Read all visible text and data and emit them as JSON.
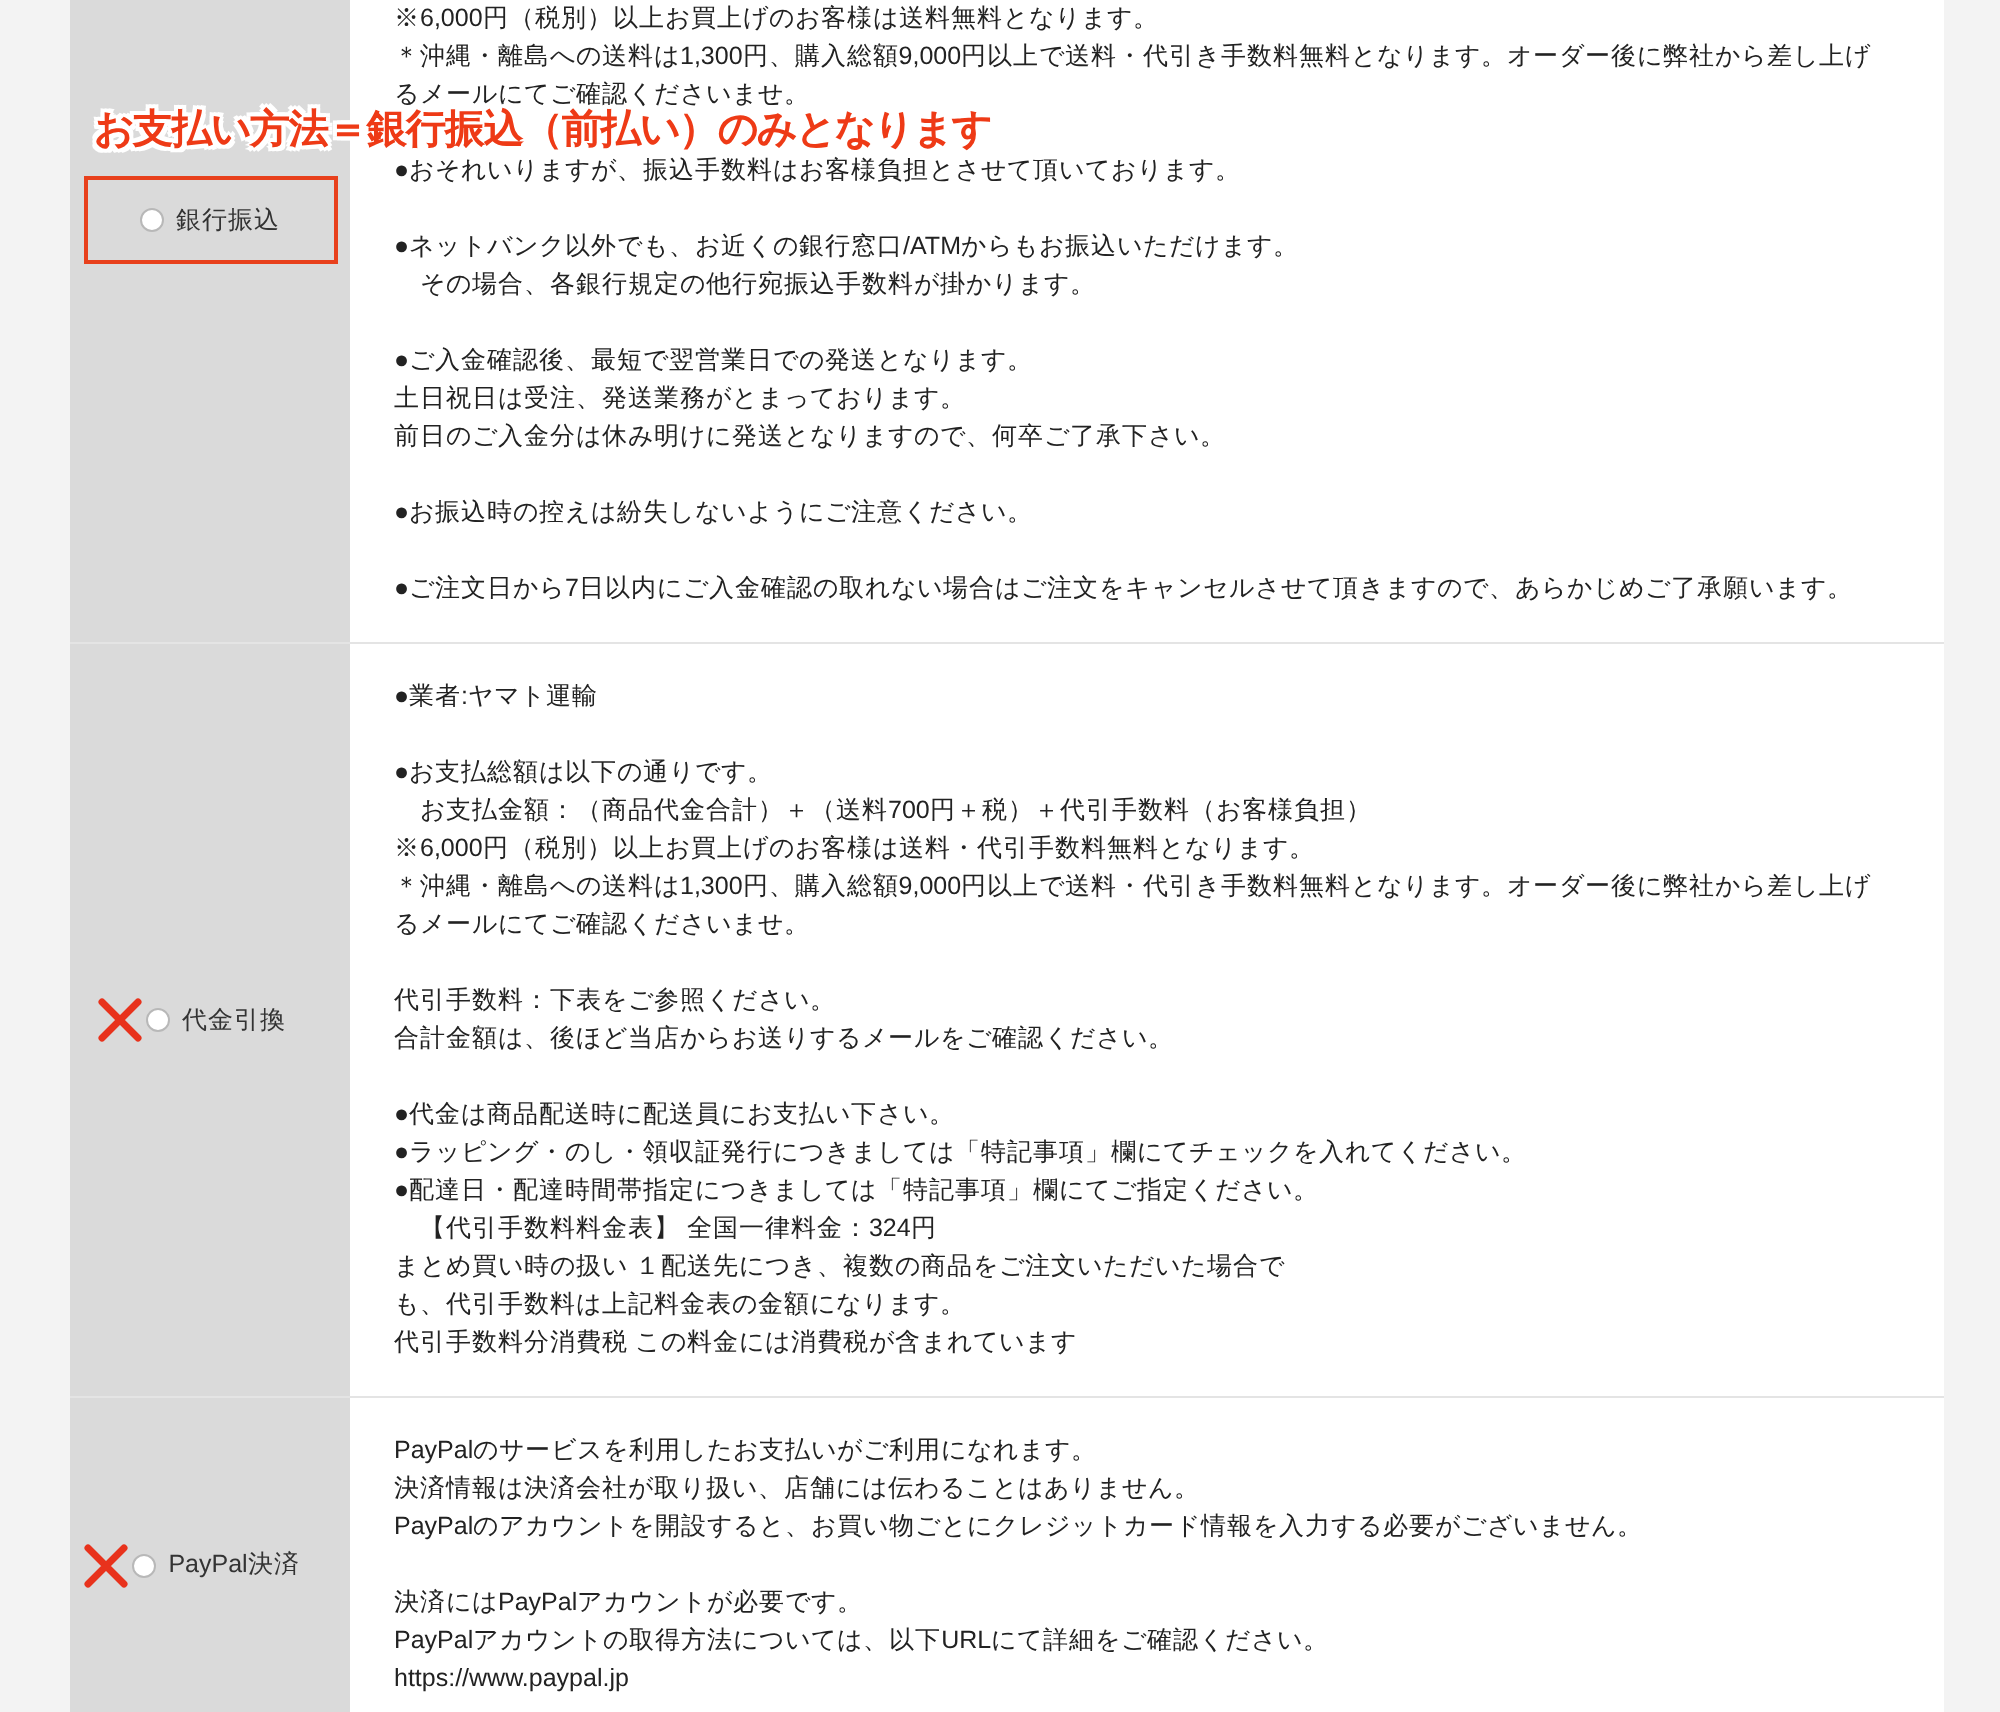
{
  "annotation": "お支払い方法＝銀行振込（前払い）のみとなります",
  "payment_methods": [
    {
      "label": "銀行振込",
      "selected": false,
      "highlighted": true,
      "crossed_out": false,
      "paragraphs": [
        [
          "※6,000円（税別）以上お買上げのお客様は送料無料となります。",
          "＊沖縄・離島への送料は1,300円、購入総額9,000円以上で送料・代引き手数料無料となります。オーダー後に弊社から差し上げ",
          "るメールにてご確認くださいませ。"
        ],
        [
          "●おそれいりますが、振込手数料はお客様負担とさせて頂いております。"
        ],
        [
          "●ネットバンク以外でも、お近くの銀行窓口/ATMからもお振込いただけます。",
          "　その場合、各銀行規定の他行宛振込手数料が掛かります。"
        ],
        [
          "●ご入金確認後、最短で翌営業日での発送となります。",
          "土日祝日は受注、発送業務がとまっております。",
          "前日のご入金分は休み明けに発送となりますので、何卒ご了承下さい。"
        ],
        [
          "●お振込時の控えは紛失しないようにご注意ください。"
        ],
        [
          "●ご注文日から7日以内にご入金確認の取れない場合はご注文をキャンセルさせて頂きますので、あらかじめご了承願います。"
        ]
      ]
    },
    {
      "label": "代金引換",
      "selected": false,
      "highlighted": false,
      "crossed_out": true,
      "paragraphs": [
        [
          "●業者:ヤマト運輸"
        ],
        [
          "●お支払総額は以下の通りです。",
          "　お支払金額：（商品代金合計）＋（送料700円＋税）＋代引手数料（お客様負担）",
          "※6,000円（税別）以上お買上げのお客様は送料・代引手数料無料となります。",
          "＊沖縄・離島への送料は1,300円、購入総額9,000円以上で送料・代引き手数料無料となります。オーダー後に弊社から差し上げ",
          "るメールにてご確認くださいませ。"
        ],
        [
          "代引手数料：下表をご参照ください。",
          "合計金額は、後ほど当店からお送りするメールをご確認ください。"
        ],
        [
          "●代金は商品配送時に配送員にお支払い下さい。",
          "●ラッピング・のし・領収証発行につきましては「特記事項」欄にてチェックを入れてください。",
          "●配達日・配達時間帯指定につきましては「特記事項」欄にてご指定ください。",
          "　【代引手数料料金表】 全国一律料金：324円",
          "まとめ買い時の扱い １配送先につき、複数の商品をご注文いただいた場合で",
          "も、代引手数料は上記料金表の金額になります。",
          "代引手数料分消費税 この料金には消費税が含まれています"
        ]
      ]
    },
    {
      "label": "PayPal決済",
      "selected": false,
      "highlighted": false,
      "crossed_out": true,
      "paragraphs": [
        [
          "PayPalのサービスを利用したお支払いがご利用になれます。",
          "決済情報は決済会社が取り扱い、店舗には伝わることはありません。",
          "PayPalのアカウントを開設すると、お買い物ごとにクレジットカード情報を入力する必要がございません。"
        ],
        [
          "決済にはPayPalアカウントが必要です。",
          "PayPalアカウントの取得方法については、以下URLにて詳細をご確認ください。",
          "https://www.paypal.jp"
        ]
      ]
    }
  ]
}
